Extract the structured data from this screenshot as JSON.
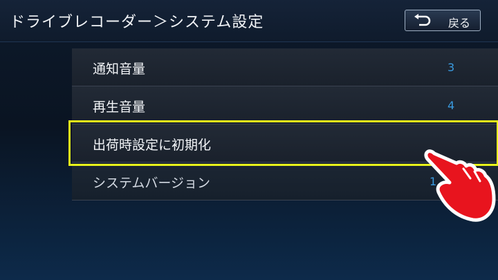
{
  "header": {
    "title": "ドライブレコーダー＞システム設定",
    "back_label": "戻る"
  },
  "settings": [
    {
      "label": "通知音量",
      "value": "3"
    },
    {
      "label": "再生音量",
      "value": "4"
    },
    {
      "label": "出荷時設定に初期化",
      "value": ""
    },
    {
      "label": "システムバージョン",
      "value": "1"
    }
  ],
  "colors": {
    "accent_value": "#3a9be0",
    "highlight_border": "#e8f21a",
    "hand_fill": "#e8141e"
  },
  "icons": {
    "back": "back-arrow-icon",
    "pointer": "pointing-hand-icon"
  }
}
